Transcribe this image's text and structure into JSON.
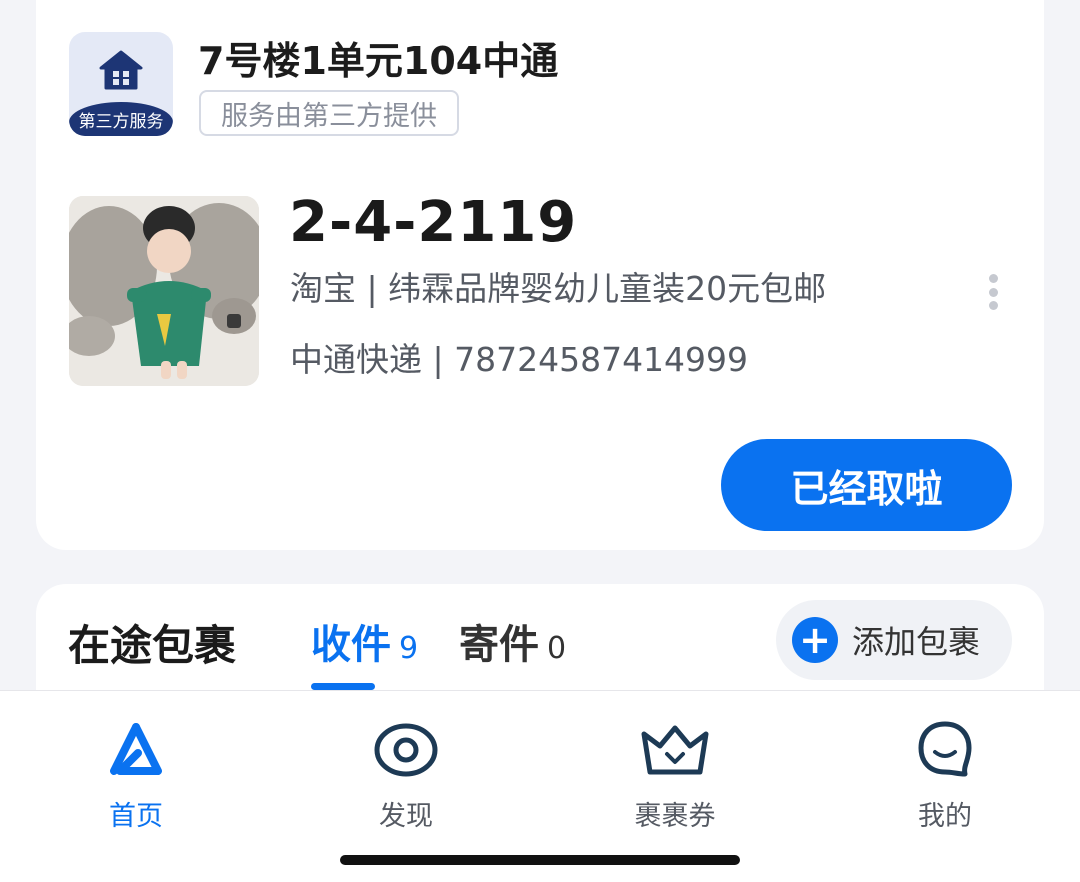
{
  "pickup_card": {
    "station_logo_text": "第三方服务",
    "station_name": "7号楼1单元104中通",
    "station_tag": "服务由第三方提供",
    "pickup_code": "2-4-2119",
    "shop_line": "淘宝 | 纬霖品牌婴幼儿童装20元包邮",
    "courier_line": "中通快递 | 78724587414999",
    "confirm_button": "已经取啦"
  },
  "transit": {
    "title": "在途包裹",
    "tabs": [
      {
        "label": "收件",
        "count": "9",
        "active": true
      },
      {
        "label": "寄件",
        "count": "0",
        "active": false
      }
    ],
    "add_button": "添加包裹"
  },
  "bottom_nav": {
    "items": [
      {
        "label": "首页",
        "icon": "home-a-icon",
        "active": true
      },
      {
        "label": "发现",
        "icon": "discover-icon",
        "active": false
      },
      {
        "label": "裹裹券",
        "icon": "crown-coupon-icon",
        "active": false
      },
      {
        "label": "我的",
        "icon": "profile-face-icon",
        "active": false
      }
    ]
  },
  "colors": {
    "accent": "#0a72f0",
    "logo_band": "#1d3575",
    "background": "#f3f4f8"
  }
}
